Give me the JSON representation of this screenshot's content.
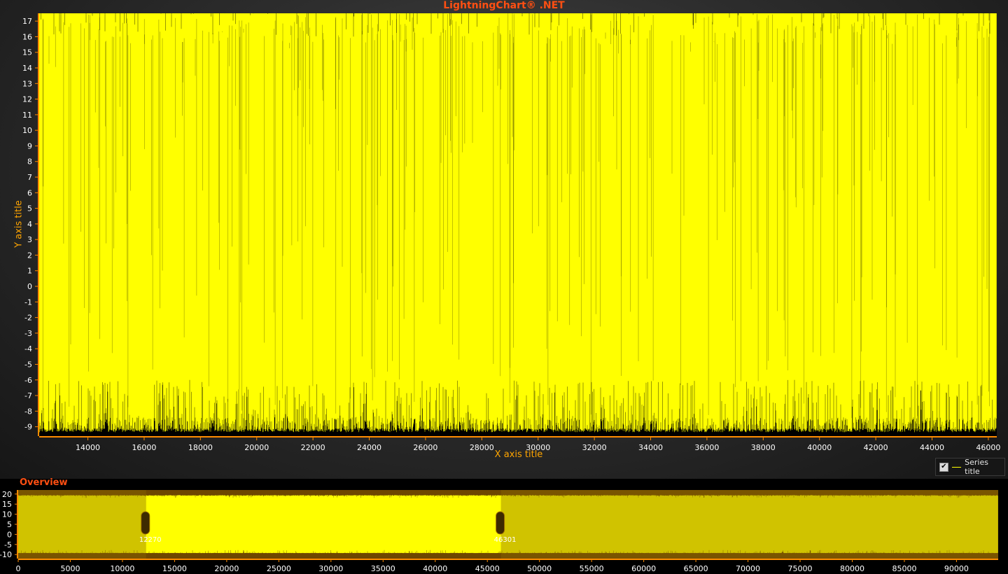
{
  "chart_title": "LightningChart® .NET",
  "chart_data": [
    {
      "type": "line",
      "title": "LightningChart® .NET",
      "xlabel": "X axis title",
      "ylabel": "Y axis title",
      "xlim": [
        12270,
        46301
      ],
      "ylim": [
        -9.6,
        17.5
      ],
      "x_ticks": [
        14000,
        16000,
        18000,
        20000,
        22000,
        24000,
        26000,
        28000,
        30000,
        32000,
        34000,
        36000,
        38000,
        40000,
        42000,
        44000,
        46000
      ],
      "y_ticks": [
        -9,
        -8,
        -7,
        -6,
        -5,
        -4,
        -3,
        -2,
        -1,
        0,
        1,
        2,
        3,
        4,
        5,
        6,
        7,
        8,
        9,
        10,
        11,
        12,
        13,
        14,
        15,
        16,
        17
      ],
      "series": [
        {
          "name": "Series title",
          "color": "#ffff00",
          "description": "dense oscillating signal filling the full range"
        }
      ],
      "legend_position": "bottom-right",
      "grid": false
    },
    {
      "type": "line",
      "title": "Overview",
      "xlim": [
        0,
        94000
      ],
      "ylim": [
        -12,
        22
      ],
      "x_ticks": [
        0,
        5000,
        10000,
        15000,
        20000,
        25000,
        30000,
        35000,
        40000,
        45000,
        50000,
        55000,
        60000,
        65000,
        70000,
        75000,
        80000,
        85000,
        90000
      ],
      "y_ticks": [
        -10,
        -5,
        0,
        5,
        10,
        15,
        20
      ],
      "selection_range": [
        12270,
        46301
      ],
      "selection_labels": [
        "12270",
        "46301"
      ],
      "grid": false
    }
  ],
  "legend": {
    "checked": true,
    "check_glyph": "✔",
    "label": "Series title"
  },
  "colors": {
    "series": "#ffff00",
    "title": "#ff4f12",
    "axis_title": "#ffa500",
    "axis": "#ff8c00",
    "overview_band": "#6e4800"
  }
}
